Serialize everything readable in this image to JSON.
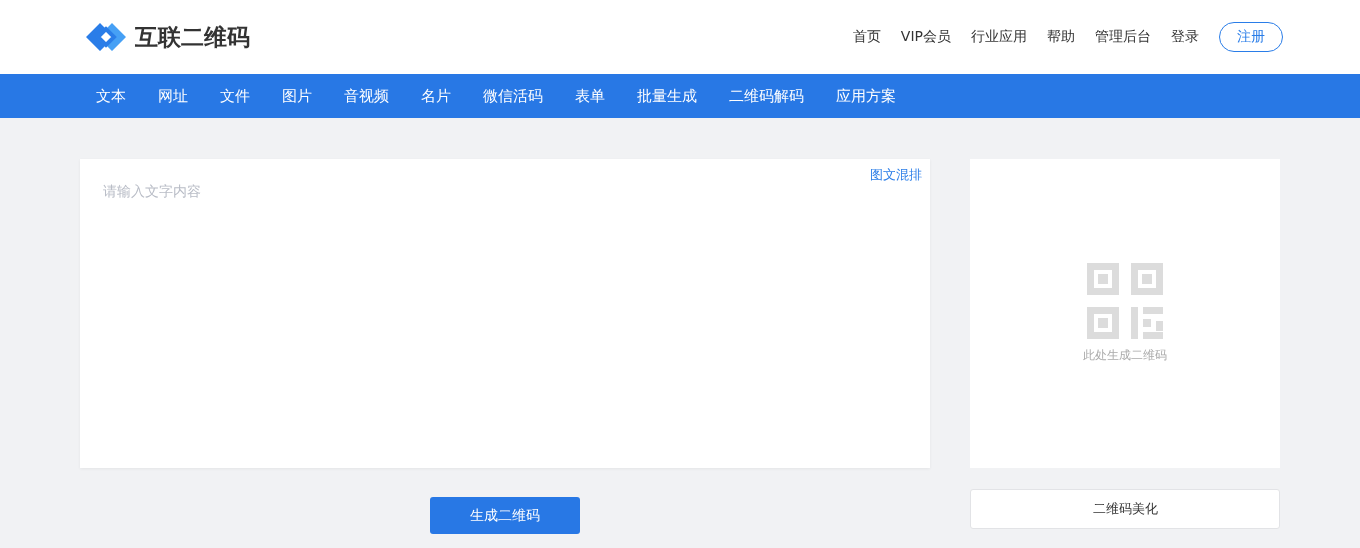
{
  "logo": {
    "text": "互联二维码"
  },
  "top_links": [
    "首页",
    "VIP会员",
    "行业应用",
    "帮助",
    "管理后台",
    "登录"
  ],
  "register_button": "注册",
  "nav": [
    "文本",
    "网址",
    "文件",
    "图片",
    "音视频",
    "名片",
    "微信活码",
    "表单",
    "批量生成",
    "二维码解码",
    "应用方案"
  ],
  "editor": {
    "mode_link": "图文混排",
    "placeholder": "请输入文字内容"
  },
  "generate_button": "生成二维码",
  "preview": {
    "hint": "此处生成二维码"
  },
  "beautify_button": "二维码美化"
}
